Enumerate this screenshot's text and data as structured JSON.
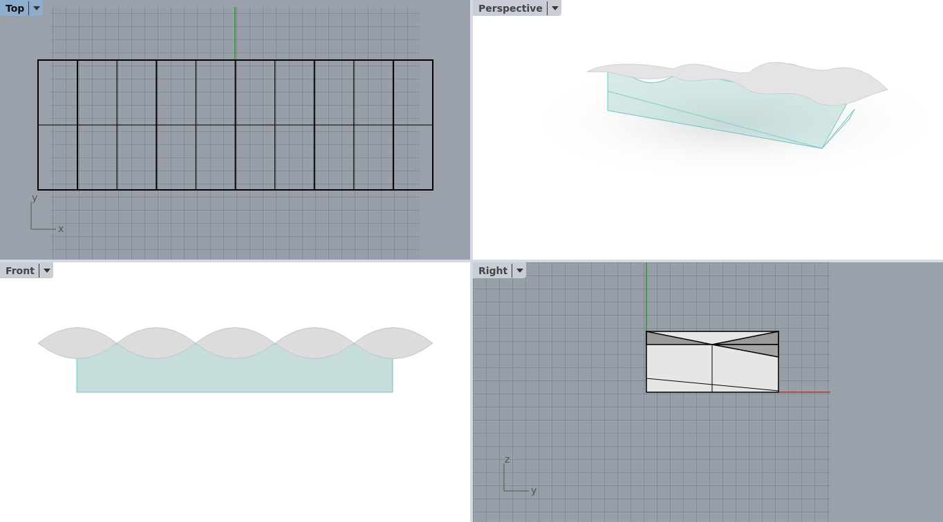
{
  "viewports": [
    {
      "title": "Top",
      "selected": true,
      "kind": "top",
      "axes": {
        "horizontal": "x",
        "vertical": "y"
      }
    },
    {
      "title": "Perspective",
      "selected": false,
      "kind": "perspective"
    },
    {
      "title": "Front",
      "selected": false,
      "kind": "front"
    },
    {
      "title": "Right",
      "selected": false,
      "kind": "right",
      "axes": {
        "horizontal": "y",
        "vertical": "z"
      }
    }
  ]
}
